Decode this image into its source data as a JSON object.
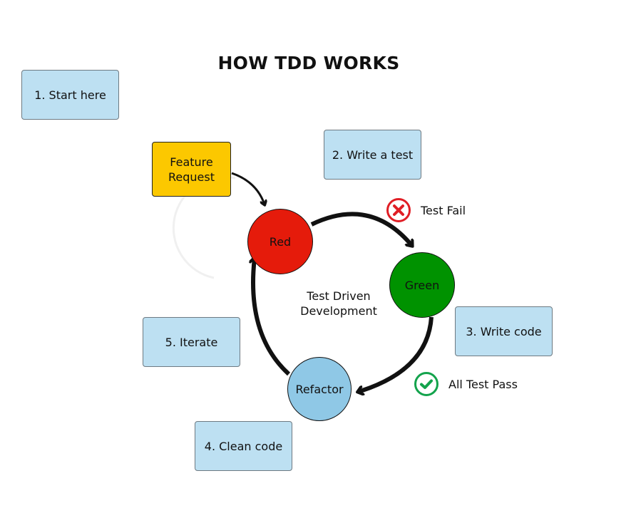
{
  "title": "HOW TDD WORKS",
  "steps": [
    {
      "label": "1. Start here"
    },
    {
      "label": "2. Write a test"
    },
    {
      "label": "3. Write code"
    },
    {
      "label": "4. Clean code"
    },
    {
      "label": "5. Iterate"
    }
  ],
  "feature_request": {
    "line1": "Feature",
    "line2": "Request"
  },
  "nodes": {
    "red": {
      "label": "Red",
      "color": "#e51b0b"
    },
    "green": {
      "label": "Green",
      "color": "#009200"
    },
    "refactor": {
      "label": "Refactor",
      "color": "#8fc8e6"
    }
  },
  "center": {
    "line1": "Test Driven",
    "line2": "Development"
  },
  "statuses": {
    "fail": {
      "label": "Test Fail",
      "icon": "x-circle-icon",
      "color": "#e01e25"
    },
    "pass": {
      "label": "All Test Pass",
      "icon": "check-circle-icon",
      "color": "#13a34c"
    }
  }
}
